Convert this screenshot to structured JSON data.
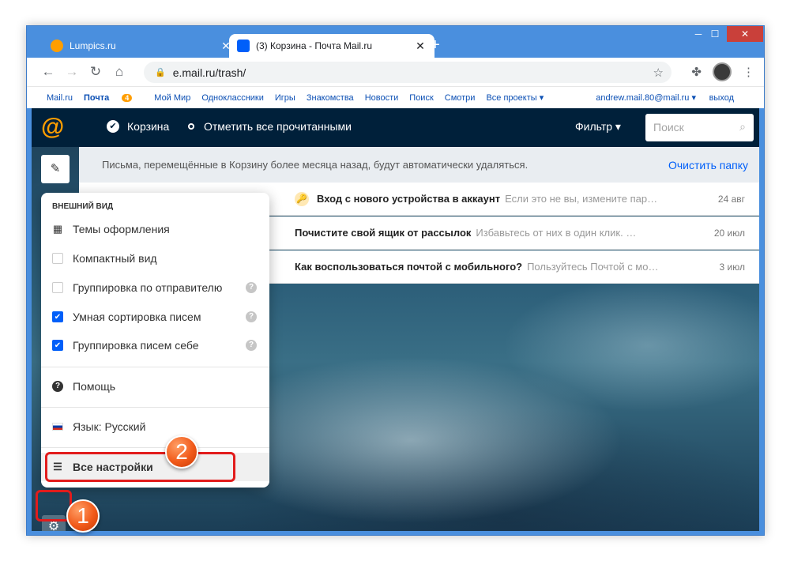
{
  "browser": {
    "tabs": [
      {
        "title": "Lumpics.ru",
        "favicon": "orange-circle"
      },
      {
        "title": "(3) Корзина - Почта Mail.ru",
        "favicon": "mail-envelope"
      }
    ],
    "new_tab": "+",
    "url": "e.mail.ru/trash/",
    "window_controls": {
      "minimize": "─",
      "maximize": "☐",
      "close": "✕"
    }
  },
  "portal": {
    "links": [
      "Mail.ru",
      "Почта",
      "Мой Мир",
      "Одноклассники",
      "Игры",
      "Знакомства",
      "Новости",
      "Поиск",
      "Смотри",
      "Все проекты ▾"
    ],
    "mail_count": "4",
    "user": "andrew.mail.80@mail.ru ▾",
    "exit": "выход"
  },
  "mail": {
    "folder": "Корзина",
    "mark_read": "Отметить все прочитанными",
    "filter": "Фильтр",
    "search_placeholder": "Поиск",
    "notice": "Письма, перемещённые в Корзину более месяца назад, будут автоматически удаляться.",
    "clear_folder": "Очистить папку",
    "messages": [
      {
        "subject": "Вход с нового устройства в аккаунт",
        "snippet": "Если это не вы, измените пар…",
        "date": "24 авг"
      },
      {
        "subject": "Почистите свой ящик от рассылок",
        "snippet": "Избавьтесь от них в один клик. Мног…",
        "date": "20 июл"
      },
      {
        "subject": "Как воспользоваться почтой с мобильного?",
        "snippet": "Пользуйтесь Почтой с мо…",
        "date": "3 июл"
      }
    ]
  },
  "menu": {
    "header": "ВНЕШНИЙ ВИД",
    "themes": "Темы оформления",
    "compact": "Компактный вид",
    "group_sender": "Группировка по отправителю",
    "smart_sort": "Умная сортировка писем",
    "group_self": "Группировка писем себе",
    "help": "Помощь",
    "language": "Язык: Русский",
    "all_settings": "Все настройки"
  },
  "annotations": {
    "step1": "1",
    "step2": "2"
  },
  "colors": {
    "accent": "#005ff9",
    "header_bg": "#00203a",
    "highlight": "#e21c1c",
    "badge": "#f15a1a"
  }
}
